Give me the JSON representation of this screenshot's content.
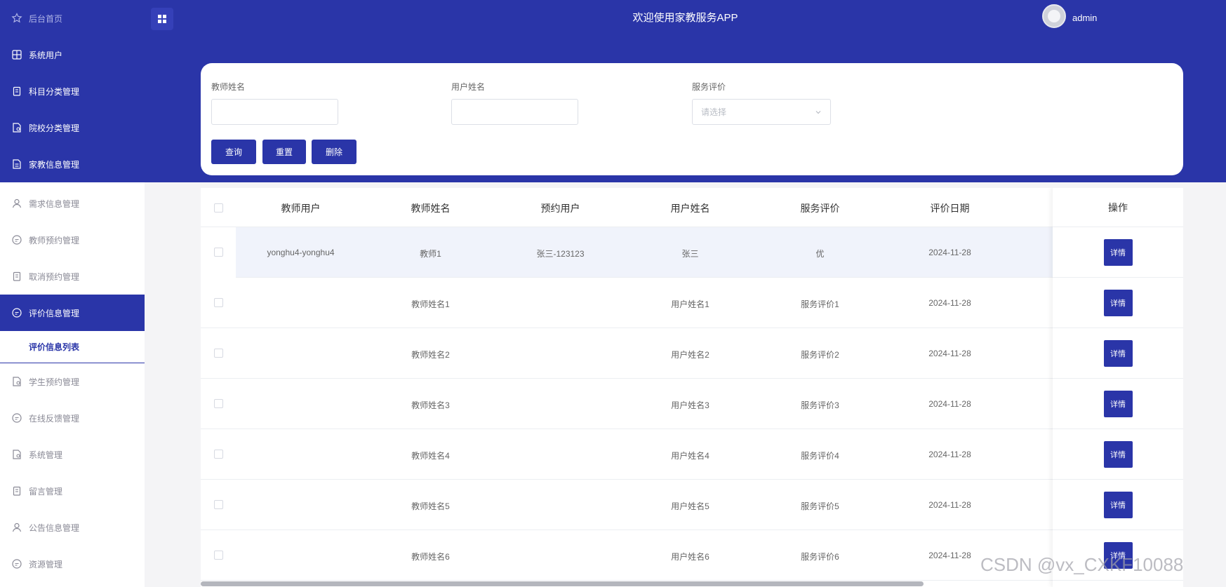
{
  "sidebar": {
    "top_items": [
      {
        "label": "后台首页",
        "icon": "star-icon"
      },
      {
        "label": "系统用户",
        "icon": "grid-icon"
      },
      {
        "label": "科目分类管理",
        "icon": "clipboard-icon"
      },
      {
        "label": "院校分类管理",
        "icon": "document-icon"
      },
      {
        "label": "家教信息管理",
        "icon": "document-icon"
      }
    ],
    "items": [
      {
        "label": "需求信息管理",
        "icon": "user-icon"
      },
      {
        "label": "教师预约管理",
        "icon": "chat-icon"
      },
      {
        "label": "取消预约管理",
        "icon": "clipboard-icon"
      },
      {
        "label": "评价信息管理",
        "icon": "chat-icon",
        "active": true
      },
      {
        "label": "评价信息列表",
        "sub": true
      },
      {
        "label": "学生预约管理",
        "icon": "document-icon"
      },
      {
        "label": "在线反馈管理",
        "icon": "chat-icon"
      },
      {
        "label": "系统管理",
        "icon": "document-icon"
      },
      {
        "label": "留言管理",
        "icon": "clipboard-icon"
      },
      {
        "label": "公告信息管理",
        "icon": "user-icon"
      },
      {
        "label": "资源管理",
        "icon": "chat-icon"
      }
    ]
  },
  "header": {
    "title": "欢迎使用家教服务APP",
    "username": "admin"
  },
  "search": {
    "teacher_name_label": "教师姓名",
    "user_name_label": "用户姓名",
    "service_rating_label": "服务评价",
    "teacher_name_value": "",
    "user_name_value": "",
    "service_rating_placeholder": "请选择",
    "query_button": "查询",
    "reset_button": "重置",
    "delete_button": "删除"
  },
  "table": {
    "columns": [
      "教师用户",
      "教师姓名",
      "预约用户",
      "用户姓名",
      "服务评价",
      "评价日期",
      "操作"
    ],
    "rows": [
      {
        "teacher_user": "yonghu4-yonghu4",
        "teacher_name": "教师1",
        "booking_user": "张三-123123",
        "user_name": "张三",
        "rating": "优",
        "date": "2024-11-28"
      },
      {
        "teacher_user": "",
        "teacher_name": "教师姓名1",
        "booking_user": "",
        "user_name": "用户姓名1",
        "rating": "服务评价1",
        "date": "2024-11-28"
      },
      {
        "teacher_user": "",
        "teacher_name": "教师姓名2",
        "booking_user": "",
        "user_name": "用户姓名2",
        "rating": "服务评价2",
        "date": "2024-11-28"
      },
      {
        "teacher_user": "",
        "teacher_name": "教师姓名3",
        "booking_user": "",
        "user_name": "用户姓名3",
        "rating": "服务评价3",
        "date": "2024-11-28"
      },
      {
        "teacher_user": "",
        "teacher_name": "教师姓名4",
        "booking_user": "",
        "user_name": "用户姓名4",
        "rating": "服务评价4",
        "date": "2024-11-28"
      },
      {
        "teacher_user": "",
        "teacher_name": "教师姓名5",
        "booking_user": "",
        "user_name": "用户姓名5",
        "rating": "服务评价5",
        "date": "2024-11-28"
      },
      {
        "teacher_user": "",
        "teacher_name": "教师姓名6",
        "booking_user": "",
        "user_name": "用户姓名6",
        "rating": "服务评价6",
        "date": "2024-11-28"
      }
    ],
    "detail_button": "详情"
  },
  "watermark": "CSDN @vx_CXKF10088",
  "colors": {
    "primary": "#2a35a8",
    "sidebar_text": "#8a8a96",
    "page_bg": "#f4f4f6"
  }
}
